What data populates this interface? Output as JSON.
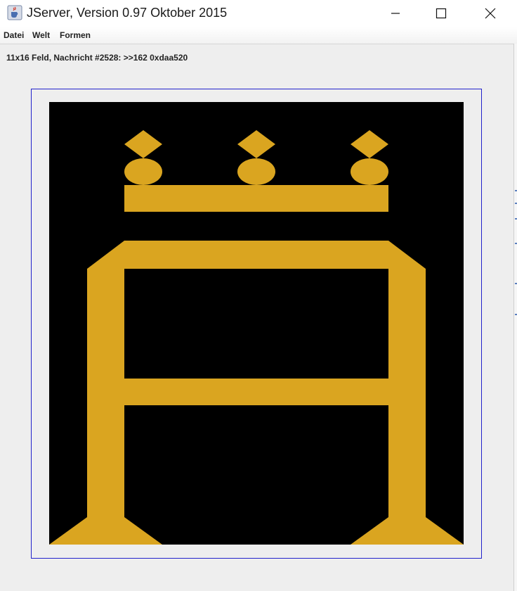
{
  "window": {
    "title": "JServer, Version 0.97 Oktober 2015",
    "app_icon": "java-cup-icon",
    "controls": [
      "minimize-icon",
      "maximize-icon",
      "close-icon"
    ]
  },
  "menu": {
    "items": [
      {
        "label": "Datei"
      },
      {
        "label": "Welt"
      },
      {
        "label": "Formen"
      }
    ]
  },
  "status": {
    "text": "11x16 Feld, Nachricht #2528: >>162 0xdaa520"
  },
  "board": {
    "background": "#000000",
    "shape_color": "#daa520",
    "frame_color": "#2222cc"
  }
}
